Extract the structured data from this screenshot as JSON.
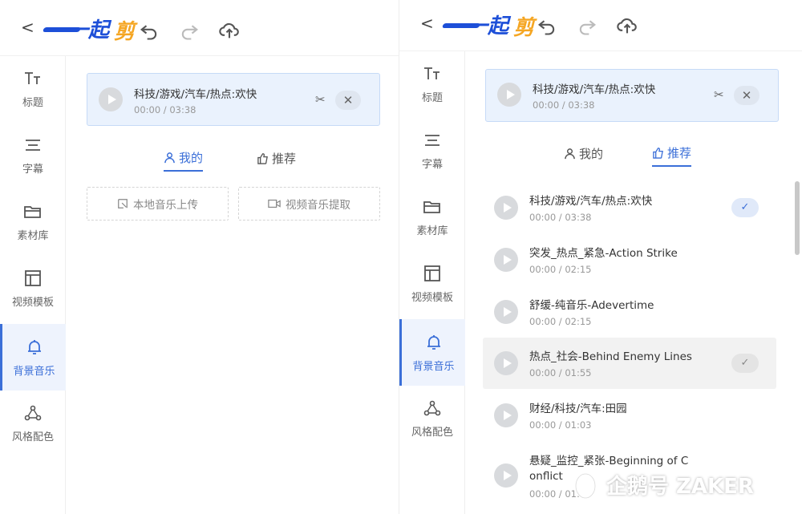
{
  "app": {
    "back_glyph": "<",
    "logo_text_1": "一起",
    "logo_text_2": "剪"
  },
  "sidebar": {
    "items": [
      {
        "label": "标题",
        "icon": "text-icon"
      },
      {
        "label": "字幕",
        "icon": "subtitle-icon"
      },
      {
        "label": "素材库",
        "icon": "folder-icon"
      },
      {
        "label": "视频模板",
        "icon": "template-icon"
      },
      {
        "label": "背景音乐",
        "icon": "bell-icon"
      },
      {
        "label": "风格配色",
        "icon": "style-icon"
      }
    ],
    "active_index": 4
  },
  "current_track": {
    "title": "科技/游戏/汽车/热点:欢快",
    "time": "00:00 / 03:38",
    "scissor_glyph": "✂",
    "close_glyph": "✕"
  },
  "tabs": {
    "mine": "我的",
    "recommend": "推荐"
  },
  "upload": {
    "local": "本地音乐上传",
    "extract": "视频音乐提取"
  },
  "track_list": [
    {
      "title": "科技/游戏/汽车/热点:欢快",
      "time": "00:00 / 03:38",
      "selected": true
    },
    {
      "title": "突发_热点_紧急-Action Strike",
      "time": "00:00 / 02:15",
      "selected": false
    },
    {
      "title": "舒缓-纯音乐-Adevertime",
      "time": "00:00 / 02:15",
      "selected": false
    },
    {
      "title": "热点_社会-Behind Enemy Lines",
      "time": "00:00 / 01:55",
      "selected": false,
      "hover": true
    },
    {
      "title": "财经/科技/汽车:田园",
      "time": "00:00 / 01:03",
      "selected": false
    },
    {
      "title_line1": "悬疑_监控_紧张-Beginning of C",
      "title_line2": "onflict",
      "time": "00:00 / 01:",
      "selected": false
    }
  ],
  "check_glyph": "✓",
  "watermark": {
    "text": "企鹅号 ZAKER"
  },
  "colors": {
    "accent": "#3b6fd8",
    "logo_blue": "#1d4fd8",
    "logo_orange": "#f5a623"
  }
}
